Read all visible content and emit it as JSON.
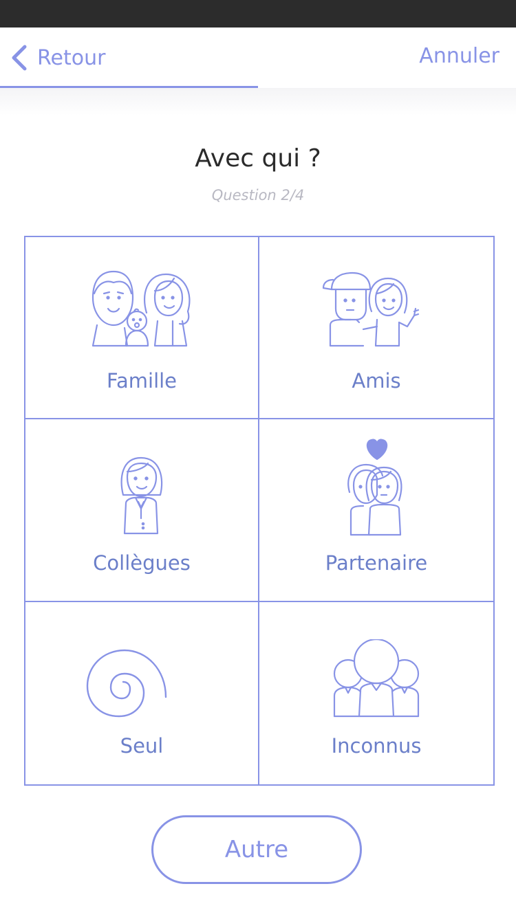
{
  "nav": {
    "back_label": "Retour",
    "cancel_label": "Annuler",
    "progress": 0.5
  },
  "header": {
    "title": "Avec qui ?",
    "subtitle": "Question 2/4"
  },
  "options": [
    {
      "label": "Famille",
      "icon": "family-icon"
    },
    {
      "label": "Amis",
      "icon": "friends-icon"
    },
    {
      "label": "Collègues",
      "icon": "colleague-icon"
    },
    {
      "label": "Partenaire",
      "icon": "couple-heart-icon"
    },
    {
      "label": "Seul",
      "icon": "spiral-icon"
    },
    {
      "label": "Inconnus",
      "icon": "crowd-icon"
    }
  ],
  "other_button": {
    "label": "Autre"
  },
  "colors": {
    "accent": "#8893e6",
    "label": "#6b7fc9",
    "status_bar": "#2c2c2c"
  }
}
